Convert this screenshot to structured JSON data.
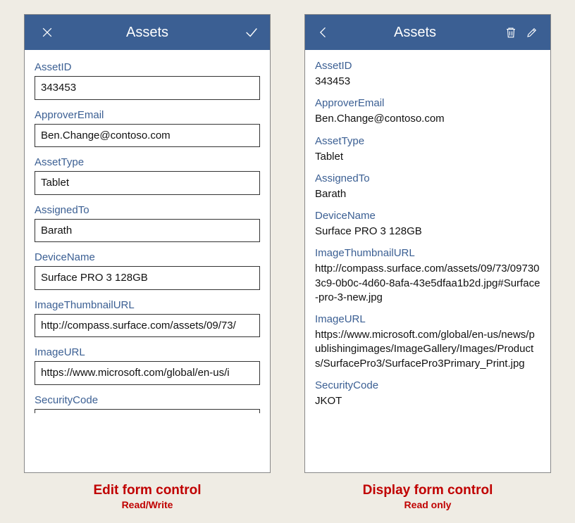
{
  "screens": {
    "edit": {
      "title": "Assets",
      "fields": [
        {
          "label": "AssetID",
          "value": "343453"
        },
        {
          "label": "ApproverEmail",
          "value": "Ben.Change@contoso.com"
        },
        {
          "label": "AssetType",
          "value": "Tablet"
        },
        {
          "label": "AssignedTo",
          "value": "Barath"
        },
        {
          "label": "DeviceName",
          "value": "Surface PRO 3 128GB"
        },
        {
          "label": "ImageThumbnailURL",
          "value": "http://compass.surface.com/assets/09/73/"
        },
        {
          "label": "ImageURL",
          "value": "https://www.microsoft.com/global/en-us/i"
        },
        {
          "label": "SecurityCode",
          "value": ""
        }
      ]
    },
    "display": {
      "title": "Assets",
      "fields": [
        {
          "label": "AssetID",
          "value": "343453"
        },
        {
          "label": "ApproverEmail",
          "value": "Ben.Change@contoso.com"
        },
        {
          "label": "AssetType",
          "value": "Tablet"
        },
        {
          "label": "AssignedTo",
          "value": "Barath"
        },
        {
          "label": "DeviceName",
          "value": "Surface PRO 3 128GB"
        },
        {
          "label": "ImageThumbnailURL",
          "value": "http://compass.surface.com/assets/09/73/097303c9-0b0c-4d60-8afa-43e5dfaa1b2d.jpg#Surface-pro-3-new.jpg"
        },
        {
          "label": "ImageURL",
          "value": "https://www.microsoft.com/global/en-us/news/publishingimages/ImageGallery/Images/Products/SurfacePro3/SurfacePro3Primary_Print.jpg"
        },
        {
          "label": "SecurityCode",
          "value": "JKOT"
        }
      ]
    }
  },
  "captions": {
    "edit": {
      "main": "Edit form control",
      "sub": "Read/Write"
    },
    "display": {
      "main": "Display form control",
      "sub": "Read only"
    }
  }
}
